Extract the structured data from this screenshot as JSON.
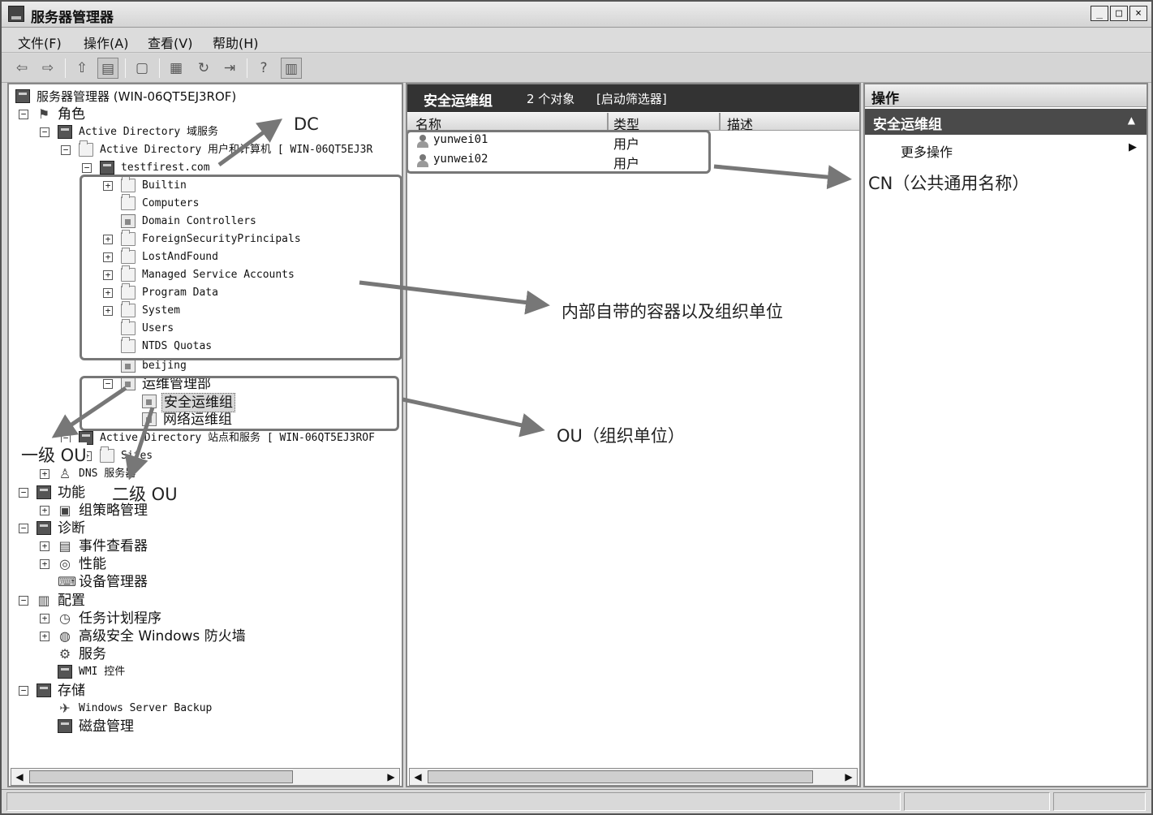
{
  "window": {
    "title": "服务器管理器"
  },
  "menubar": [
    "文件(F)",
    "操作(A)",
    "查看(V)",
    "帮助(H)"
  ],
  "toolbar": {
    "icons": [
      "back-icon",
      "forward-icon",
      "up-icon",
      "show-hide-tree-icon",
      "copy-icon",
      "properties-icon",
      "refresh-icon",
      "export-icon",
      "help-icon",
      "show-hide-action-icon"
    ]
  },
  "tree": {
    "root": "服务器管理器 (WIN-06QT5EJ3ROF)",
    "roles": "角色",
    "ad_ds": "Active Directory 域服务",
    "ad_uc": "Active Directory 用户和计算机 [ WIN-06QT5EJ3R",
    "domain": "testfirest.com",
    "builtin": "Builtin",
    "computers": "Computers",
    "domain_controllers": "Domain Controllers",
    "fsp": "ForeignSecurityPrincipals",
    "lost_and_found": "LostAndFound",
    "msa": "Managed Service Accounts",
    "program_data": "Program Data",
    "system": "System",
    "users": "Users",
    "ntds_quotas": "NTDS Quotas",
    "beijing": "beijing",
    "ops_dept": "运维管理部",
    "sec_ops": "安全运维组",
    "net_ops": "网络运维组",
    "ad_sites": "Active Directory 站点和服务 [ WIN-06QT5EJ3ROF",
    "sites": "Sites",
    "dns": "DNS 服务器",
    "features": "功能",
    "gpm": "组策略管理",
    "diagnostics": "诊断",
    "event_viewer": "事件查看器",
    "performance": "性能",
    "device_manager": "设备管理器",
    "configuration": "配置",
    "task_scheduler": "任务计划程序",
    "firewall": "高级安全 Windows 防火墙",
    "services": "服务",
    "wmi": "WMI 控件",
    "storage": "存储",
    "wsb": "Windows Server Backup",
    "disk_mgmt": "磁盘管理"
  },
  "center": {
    "title": "安全运维组",
    "count": "2 个对象",
    "filter": "[启动筛选器]",
    "columns": [
      "名称",
      "类型",
      "描述"
    ],
    "rows": [
      {
        "name": "yunwei01",
        "type": "用户"
      },
      {
        "name": "yunwei02",
        "type": "用户"
      }
    ]
  },
  "actions": {
    "title": "操作",
    "section": "安全运维组",
    "more": "更多操作"
  },
  "annotations": {
    "dc": "DC",
    "cn": "CN（公共通用名称）",
    "builtin_containers": "内部自带的容器以及组织单位",
    "ou": "OU（组织单位）",
    "first_ou": "一级 OU",
    "second_ou": "二级 OU"
  }
}
